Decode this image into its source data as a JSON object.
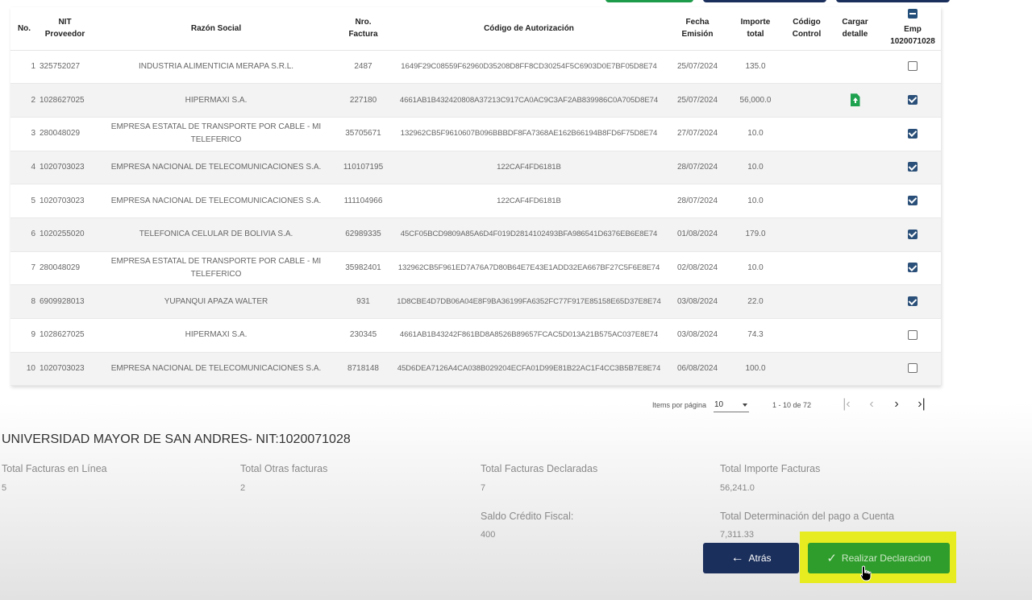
{
  "table": {
    "headers": {
      "no": "No.",
      "nit": [
        "NIT",
        "Proveedor"
      ],
      "razon": "Razón Social",
      "factura": [
        "Nro.",
        "Factura"
      ],
      "codigo": "Código de Autorización",
      "fecha": [
        "Fecha",
        "Emisión"
      ],
      "importe": [
        "Importe",
        "total"
      ],
      "control": [
        "Código",
        "Control"
      ],
      "cargar": [
        "Cargar",
        "detalle"
      ],
      "emp": [
        "Emp",
        "1020071028"
      ]
    },
    "rows": [
      {
        "no": "1",
        "nit": "325752027",
        "razon": "INDUSTRIA ALIMENTICIA MERAPA S.R.L.",
        "factura": "2487",
        "codigo": "1649F29C08559F62960D35208D8FF8CD30254F5C6903D0E7BF05D8E74",
        "fecha": "25/07/2024",
        "importe": "135.0",
        "control": "",
        "upload": false,
        "checked": false
      },
      {
        "no": "2",
        "nit": "1028627025",
        "razon": "HIPERMAXI S.A.",
        "factura": "227180",
        "codigo": "4661AB1B432420808A37213C917CA0AC9C3AF2AB839986C0A705D8E74",
        "fecha": "25/07/2024",
        "importe": "56,000.0",
        "control": "",
        "upload": true,
        "checked": true
      },
      {
        "no": "3",
        "nit": "280048029",
        "razon": "EMPRESA ESTATAL DE TRANSPORTE POR CABLE - MI TELEFERICO",
        "factura": "35705671",
        "codigo": "132962CB5F9610607B096BBBDF8FA7368AE162B66194B8FD6F75D8E74",
        "fecha": "27/07/2024",
        "importe": "10.0",
        "control": "",
        "upload": false,
        "checked": true
      },
      {
        "no": "4",
        "nit": "1020703023",
        "razon": "EMPRESA NACIONAL DE TELECOMUNICACIONES S.A.",
        "factura": "110107195",
        "codigo": "122CAF4FD6181B",
        "fecha": "28/07/2024",
        "importe": "10.0",
        "control": "",
        "upload": false,
        "checked": true
      },
      {
        "no": "5",
        "nit": "1020703023",
        "razon": "EMPRESA NACIONAL DE TELECOMUNICACIONES S.A.",
        "factura": "111104966",
        "codigo": "122CAF4FD6181B",
        "fecha": "28/07/2024",
        "importe": "10.0",
        "control": "",
        "upload": false,
        "checked": true
      },
      {
        "no": "6",
        "nit": "1020255020",
        "razon": "TELEFONICA CELULAR DE BOLIVIA S.A.",
        "factura": "62989335",
        "codigo": "45CF05BCD9809A85A6D4F019D2814102493BFA986541D6376EB6E8E74",
        "fecha": "01/08/2024",
        "importe": "179.0",
        "control": "",
        "upload": false,
        "checked": true
      },
      {
        "no": "7",
        "nit": "280048029",
        "razon": "EMPRESA ESTATAL DE TRANSPORTE POR CABLE - MI TELEFERICO",
        "factura": "35982401",
        "codigo": "132962CB5F961ED7A76A7D80B64E7E43E1ADD32EA667BF27C5F6E8E74",
        "fecha": "02/08/2024",
        "importe": "10.0",
        "control": "",
        "upload": false,
        "checked": true
      },
      {
        "no": "8",
        "nit": "6909928013",
        "razon": "YUPANQUI APAZA WALTER",
        "factura": "931",
        "codigo": "1D8CBE4D7DB06A04E8F9BA36199FA6352FC77F917E85158E65D37E8E74",
        "fecha": "03/08/2024",
        "importe": "22.0",
        "control": "",
        "upload": false,
        "checked": true
      },
      {
        "no": "9",
        "nit": "1028627025",
        "razon": "HIPERMAXI S.A.",
        "factura": "230345",
        "codigo": "4661AB1B43242F861BD8A8526B89657FCAC5D013A21B575AC037E8E74",
        "fecha": "03/08/2024",
        "importe": "74.3",
        "control": "",
        "upload": false,
        "checked": false
      },
      {
        "no": "10",
        "nit": "1020703023",
        "razon": "EMPRESA NACIONAL DE TELECOMUNICACIONES S.A.",
        "factura": "8718148",
        "codigo": "45D6DEA7126A4CA038B029204ECFA01D99E81B22AC1F4CC3B5B7E8E74",
        "fecha": "06/08/2024",
        "importe": "100.0",
        "control": "",
        "upload": false,
        "checked": false
      }
    ]
  },
  "paginator": {
    "items_label": "Items por página",
    "page_size": "10",
    "range": "1 - 10 de 72",
    "first": "|‹",
    "prev": "‹",
    "next": "›",
    "last": "›|"
  },
  "summary": {
    "org": "UNIVERSIDAD MAYOR DE SAN ANDRES- NIT:1020071028",
    "en_linea_label": "Total Facturas en Línea",
    "en_linea_value": "5",
    "otras_label": "Total Otras facturas",
    "otras_value": "2",
    "declaradas_label": "Total Facturas Declaradas",
    "declaradas_value": "7",
    "importe_label": "Total Importe Facturas",
    "importe_value": "56,241.0",
    "saldo_label": "Saldo Crédito Fiscal:",
    "saldo_value": "400",
    "determinacion_label": "Total Determinación del pago a Cuenta",
    "determinacion_value": "7,311.33"
  },
  "actions": {
    "back_label": "Atrás",
    "back_icon": "←",
    "submit_label": "Realizar Declaracion",
    "submit_icon": "✓"
  },
  "colors": {
    "navy": "#1b2f5c",
    "green": "#2e9d2c",
    "highlight": "#e6ec1f",
    "checkbox": "#2a4f78"
  }
}
